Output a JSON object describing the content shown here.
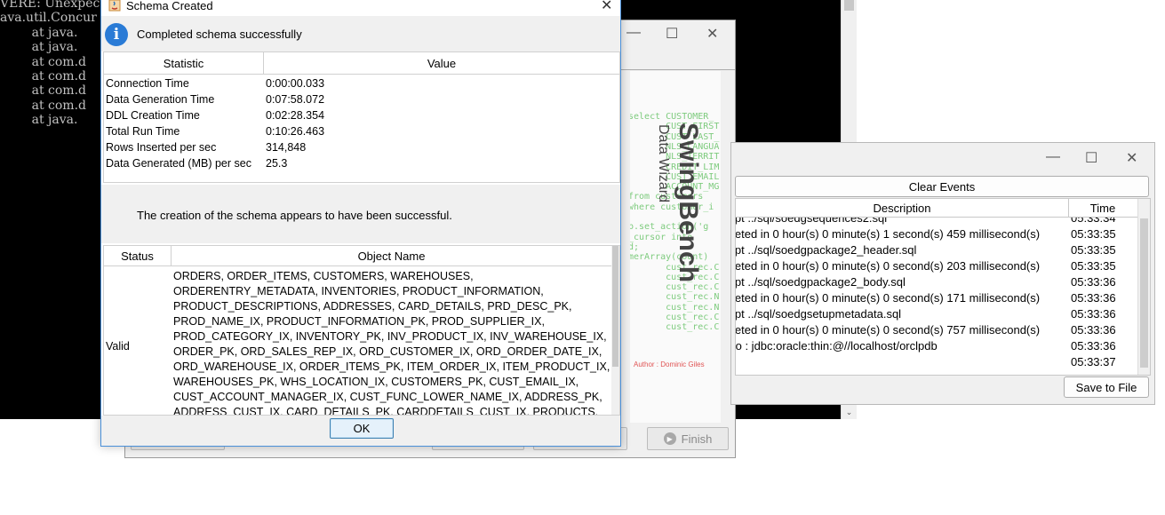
{
  "console": {
    "lines": [
      "VERE: Unexpect",
      "ava.util.Concur",
      "        at java.",
      "        at java.",
      "        at com.d",
      "        at com.d",
      "        at com.d",
      "        at com.d",
      "        at java."
    ]
  },
  "swingbench": {
    "banner_title": "SwingBench",
    "banner_subtitle": "Data Wizard",
    "author": "Author : Dominic Giles",
    "finish_label": "Finish",
    "code_lines": [
      "select CUSTOMER_",
      "       CUST_FIRST",
      "       CUST_LAST_",
      "       NLS_LANGUA",
      "       NLS_TERRIT",
      "       CREDIT_LIM",
      "       CUST_EMAIL",
      "       ACCOUNT_MG",
      "from customers",
      "where customer_i",
      "",
      "p.set_action('g",
      "_cursor into",
      "d;",
      "merArray(count)",
      "       cust_rec.C",
      "       cust_rec.C",
      "       cust_rec.C",
      "       cust_rec.N",
      "       cust_rec.N",
      "       cust_rec.C",
      "       cust_rec.C"
    ]
  },
  "events": {
    "clear_label": "Clear Events",
    "save_label": "Save to File",
    "columns": [
      "Description",
      "Time"
    ],
    "rows": [
      {
        "description": "ipt ../sql/soedgsequences2.sql",
        "time": "05:33:34"
      },
      {
        "description": "leted in 0 hour(s) 0 minute(s) 1 second(s) 459 millisecond(s)",
        "time": "05:33:35"
      },
      {
        "description": "ipt ../sql/soedgpackage2_header.sql",
        "time": "05:33:35"
      },
      {
        "description": "leted in 0 hour(s) 0 minute(s) 0 second(s) 203 millisecond(s)",
        "time": "05:33:35"
      },
      {
        "description": "ipt ../sql/soedgpackage2_body.sql",
        "time": "05:33:36"
      },
      {
        "description": "leted in 0 hour(s) 0 minute(s) 0 second(s) 171 millisecond(s)",
        "time": "05:33:36"
      },
      {
        "description": "ipt ../sql/soedgsetupmetadata.sql",
        "time": "05:33:36"
      },
      {
        "description": "leted in 0 hour(s) 0 minute(s) 0 second(s) 757 millisecond(s)",
        "time": "05:33:36"
      },
      {
        "description": " to : jdbc:oracle:thin:@//localhost/orclpdb",
        "time": "05:33:36"
      },
      {
        "description": "",
        "time": "05:33:37"
      }
    ]
  },
  "dialog": {
    "title": "Schema Created",
    "message": "Completed schema successfully",
    "stat_columns": [
      "Statistic",
      "Value"
    ],
    "stats": [
      {
        "name": "Connection Time",
        "value": "0:00:00.033"
      },
      {
        "name": "Data Generation Time",
        "value": "0:07:58.072"
      },
      {
        "name": "DDL Creation Time",
        "value": "0:02:28.354"
      },
      {
        "name": "Total Run Time",
        "value": "0:10:26.463"
      },
      {
        "name": "Rows Inserted per sec",
        "value": "314,848"
      },
      {
        "name": "Data Generated (MB) per sec",
        "value": "25.3"
      }
    ],
    "summary": "The creation of the schema appears to have been successful.",
    "object_columns": [
      "Status",
      "Object Name"
    ],
    "object_status": "Valid",
    "object_names": "ORDERS, ORDER_ITEMS, CUSTOMERS, WAREHOUSES, ORDERENTRY_METADATA, INVENTORIES, PRODUCT_INFORMATION, PRODUCT_DESCRIPTIONS, ADDRESSES, CARD_DETAILS, PRD_DESC_PK, PROD_NAME_IX, PRODUCT_INFORMATION_PK, PROD_SUPPLIER_IX, PROD_CATEGORY_IX, INVENTORY_PK, INV_PRODUCT_IX, INV_WAREHOUSE_IX, ORDER_PK, ORD_SALES_REP_IX, ORD_CUSTOMER_IX, ORD_ORDER_DATE_IX, ORD_WAREHOUSE_IX, ORDER_ITEMS_PK, ITEM_ORDER_IX, ITEM_PRODUCT_IX, WAREHOUSES_PK, WHS_LOCATION_IX, CUSTOMERS_PK, CUST_EMAIL_IX, CUST_ACCOUNT_MANAGER_IX, CUST_FUNC_LOWER_NAME_IX, ADDRESS_PK, ADDRESS_CUST_IX, CARD_DETAILS_PK, CARDDETAILS_CUST_IX, PRODUCTS, PRODUCT_PRICES, CUSTOMER_SEQ, ORDERS_SEQ, ADDRESS_SEQ",
    "ok_label": "OK"
  },
  "colors": {
    "accent": "#2a7bd6",
    "code_green": "#7ecb7e",
    "banner_title": "#444444",
    "author": "#e05555"
  }
}
